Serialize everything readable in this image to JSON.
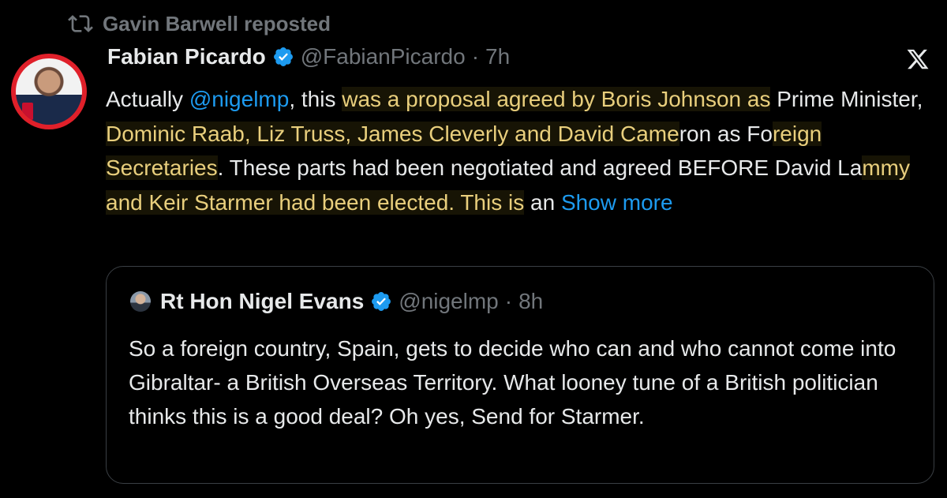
{
  "repost": {
    "icon": "repost-icon",
    "text": "Gavin Barwell reposted"
  },
  "tweet": {
    "author_name": "Fabian Picardo",
    "handle": "@FabianPicardo",
    "separator": "·",
    "time": "7h",
    "segments": [
      {
        "text": "Actually ",
        "style": "normal"
      },
      {
        "text": "@nigelmp",
        "style": "mention"
      },
      {
        "text": ", this ",
        "style": "normal"
      },
      {
        "text": "was a proposal agreed by Boris Johnson as",
        "style": "highlight"
      },
      {
        "text": " Prime Minister, ",
        "style": "normal"
      },
      {
        "text": "Dominic Raab, Liz Truss, James Cleverly and David Came",
        "style": "highlight"
      },
      {
        "text": "ron as Fo",
        "style": "normal"
      },
      {
        "text": "reign Secretaries",
        "style": "highlight"
      },
      {
        "text": ".  These parts had been negotiated and agreed BEFORE David La",
        "style": "normal"
      },
      {
        "text": "mmy and Keir Starmer had been elected.  This is",
        "style": "highlight"
      },
      {
        "text": " an ",
        "style": "normal"
      },
      {
        "text": "Show more",
        "style": "link"
      }
    ]
  },
  "quote": {
    "author_name": "Rt Hon Nigel Evans",
    "handle": "@nigelmp",
    "separator": "·",
    "time": "8h",
    "text": "So a foreign country, Spain,  gets to decide who can and who cannot come into Gibraltar- a British Overseas Territory. What looney tune of a British politician thinks this is  a good deal? Oh yes, Send for Starmer."
  },
  "colors": {
    "background": "#000000",
    "text": "#e7e9ea",
    "secondary": "#71767b",
    "link": "#1d9bf0",
    "highlight_text": "#e9cf7d",
    "verified": "#1d9bf0",
    "avatar_ring": "#e0202a"
  },
  "icons": {
    "verified": "verified-badge-icon",
    "platform": "x-logo-icon"
  }
}
